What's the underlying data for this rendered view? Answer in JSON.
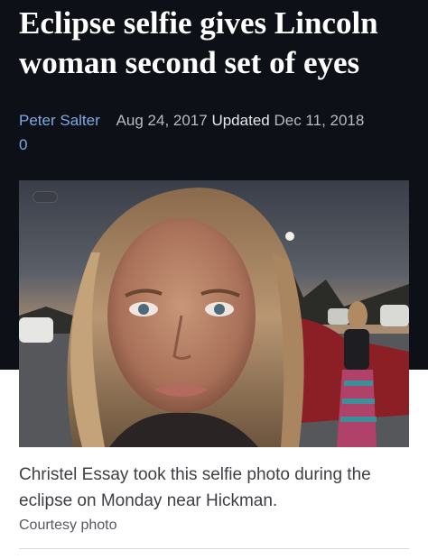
{
  "article": {
    "headline": "Eclipse selfie gives Lincoln woman second set of eyes",
    "author": "Peter Salter",
    "published": "Aug 24, 2017",
    "updated_label": "Updated",
    "updated": "Dec 11, 2018",
    "comment_count": "0"
  },
  "photo": {
    "caption": "Christel Essay took this selfie photo during the eclipse on Monday near Hickman.",
    "credit": "Courtesy photo"
  },
  "colors": {
    "hero_background": "#0d1117",
    "author_link": "#7fa9e6",
    "body_text": "#3d3f44"
  },
  "icons": {
    "camera": "camera-icon"
  }
}
